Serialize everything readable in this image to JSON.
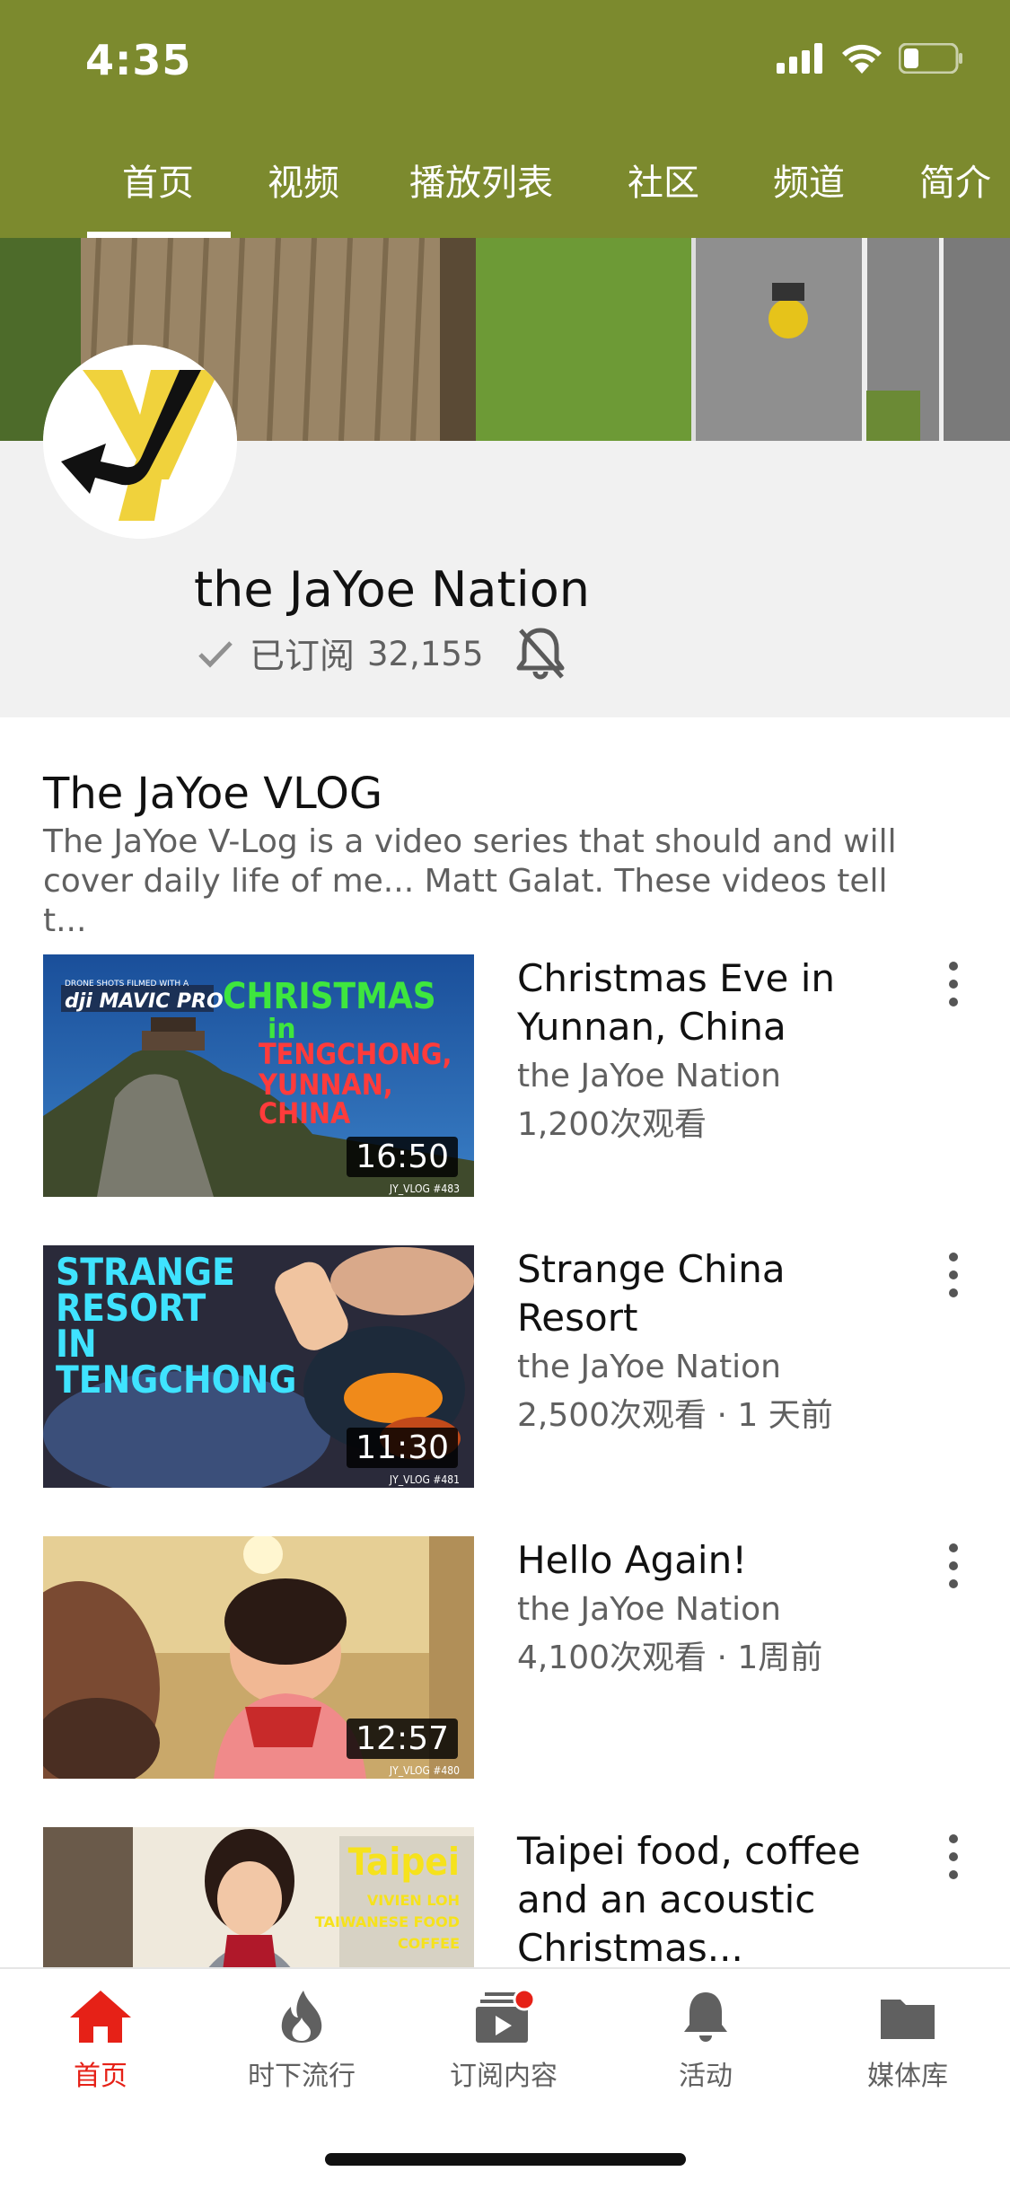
{
  "status_bar": {
    "time": "4:35"
  },
  "tabs": [
    "首页",
    "视频",
    "播放列表",
    "社区",
    "频道",
    "简介"
  ],
  "channel": {
    "name": "the JaYoe Nation",
    "subscribed_label": "已订阅",
    "subscriber_count": "32,155"
  },
  "section": {
    "title": "The JaYoe VLOG",
    "description_line1": "The JaYoe V-Log is a video series that should and will",
    "description_line2": "cover daily life of me... Matt Galat.  These videos tell t..."
  },
  "videos": [
    {
      "title": "Christmas Eve in Yunnan, China",
      "channel": "the JaYoe Nation",
      "stats": "1,200次观看",
      "duration": "16:50",
      "tag": "JY_VLOG #483",
      "thumb_badge": "DRONE SHOTS FILMED WITH A",
      "thumb_brand": "dji MAVIC PRO",
      "thumb_line1": "CHRISTMAS",
      "thumb_line2": "in",
      "thumb_line3": "TENGCHONG,",
      "thumb_line4": "YUNNAN,",
      "thumb_line5": "CHINA"
    },
    {
      "title": "Strange China Resort",
      "channel": "the JaYoe Nation",
      "stats": "2,500次观看 · 1 天前",
      "duration": "11:30",
      "tag": "JY_VLOG #481",
      "thumb_line1": "STRANGE",
      "thumb_line2": "RESORT",
      "thumb_line3": "IN",
      "thumb_line4": "TENGCHONG"
    },
    {
      "title": "Hello Again!",
      "channel": "the JaYoe Nation",
      "stats": "4,100次观看 · 1周前",
      "duration": "12:57",
      "tag": "JY_VLOG #480"
    },
    {
      "title": "Taipei food, coffee and an acoustic Christmas...",
      "thumb_line1": "Taipei",
      "thumb_line2": "VIVIEN LOH",
      "thumb_line3": "TAIWANESE FOOD",
      "thumb_line4": "COFFEE"
    }
  ],
  "bottom_nav": [
    {
      "label": "首页",
      "icon": "home-icon",
      "active": true
    },
    {
      "label": "时下流行",
      "icon": "flame-icon",
      "active": false
    },
    {
      "label": "订阅内容",
      "icon": "subscriptions-icon",
      "active": false
    },
    {
      "label": "活动",
      "icon": "bell-icon",
      "active": false
    },
    {
      "label": "媒体库",
      "icon": "folder-icon",
      "active": false
    }
  ],
  "colors": {
    "header": "#7c8a2e",
    "accent": "#e62117"
  }
}
